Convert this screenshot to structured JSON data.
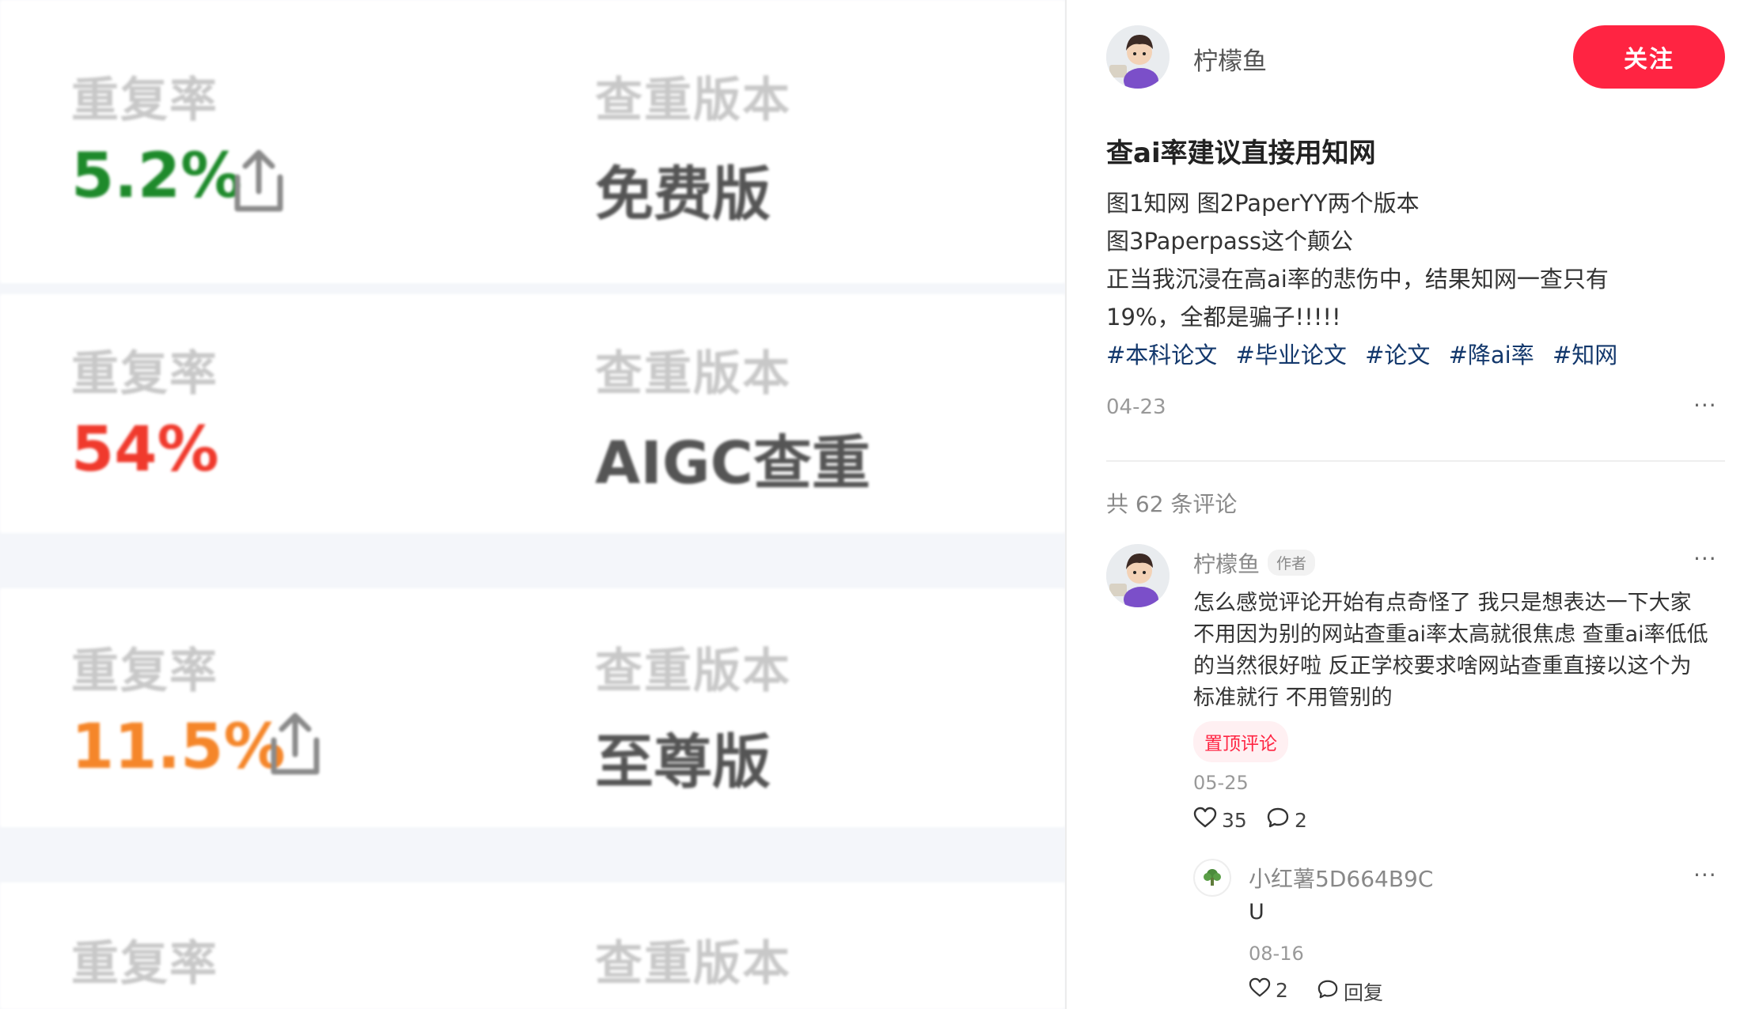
{
  "image_cards": [
    {
      "rate_label": "重复率",
      "rate_value": "5.2%",
      "rate_color": "#1e8a2b",
      "version_label": "查重版本",
      "version_value": "免费版",
      "has_share_icon": true
    },
    {
      "rate_label": "重复率",
      "rate_value": "54%",
      "rate_color": "#f03a2d",
      "version_label": "查重版本",
      "version_value": "AIGC查重",
      "has_share_icon": false
    },
    {
      "rate_label": "重复率",
      "rate_value": "11.5%",
      "rate_color": "#f5862a",
      "version_label": "查重版本",
      "version_value": "至尊版",
      "has_share_icon": true
    },
    {
      "rate_label": "重复率",
      "version_label": "查重版本"
    }
  ],
  "author": {
    "name": "柠檬鱼",
    "follow_label": "关注"
  },
  "note": {
    "title": "查ai率建议直接用知网",
    "desc_lines": [
      "图1知网  图2PaperYY两个版本",
      "图3Paperpass这个颠公",
      "正当我沉浸在高ai率的悲伤中，结果知网一查只有",
      "19%，全都是骗子!!!!!"
    ],
    "tags": [
      "#本科论文",
      "#毕业论文",
      "#论文",
      "#降ai率",
      "#知网"
    ],
    "date": "04-23",
    "more": "···"
  },
  "comments_header": "共 62 条评论",
  "comments": [
    {
      "name": "柠檬鱼",
      "author_tag": "作者",
      "lines": [
        "怎么感觉评论开始有点奇怪了 我只是想表达一下大家",
        "不用因为别的网站查重ai率太高就很焦虑 查重ai率低低",
        "的当然很好啦 反正学校要求啥网站查重直接以这个为",
        "标准就行 不用管别的"
      ],
      "pin_label": "置顶评论",
      "date": "05-25",
      "likes": "35",
      "replies": "2",
      "more": "···"
    }
  ],
  "reply": {
    "name": "小红薯5D664B9C",
    "text": "U",
    "date": "08-16",
    "likes": "2",
    "reply_label": "回复",
    "more": "···"
  },
  "colors": {
    "accent": "#ff2442",
    "tag_blue": "#13386c"
  }
}
